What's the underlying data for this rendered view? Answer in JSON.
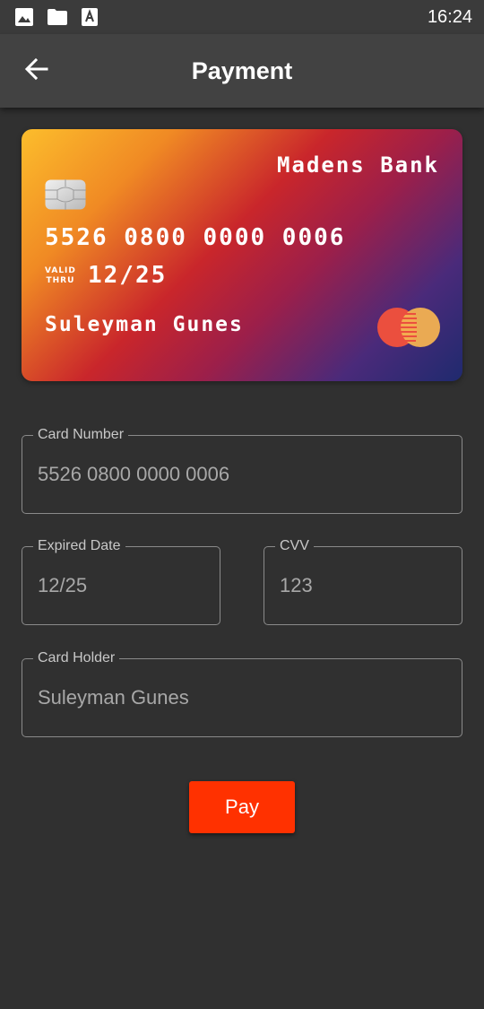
{
  "status_bar": {
    "time": "16:24",
    "icons": [
      "image-icon",
      "folder-icon",
      "font-icon"
    ]
  },
  "app_bar": {
    "title": "Payment",
    "back_icon": "arrow-left-icon"
  },
  "card": {
    "bank_name": "Madens Bank",
    "number": "5526 0800 0000 0006",
    "valid_line1": "VALID",
    "valid_line2": "THRU",
    "expiry": "12/25",
    "holder": "Suleyman Gunes",
    "network_icon": "mastercard-icon",
    "gradient_colors": [
      "#fcbd2c",
      "#c9262b",
      "#1f2a6e"
    ]
  },
  "form": {
    "card_number": {
      "label": "Card Number",
      "value": "5526 0800 0000 0006"
    },
    "expired_date": {
      "label": "Expired Date",
      "value": "12/25"
    },
    "cvv": {
      "label": "CVV",
      "value": "123"
    },
    "card_holder": {
      "label": "Card Holder",
      "value": "Suleyman Gunes"
    }
  },
  "pay_button": {
    "label": "Pay",
    "color": "#ff3100"
  }
}
